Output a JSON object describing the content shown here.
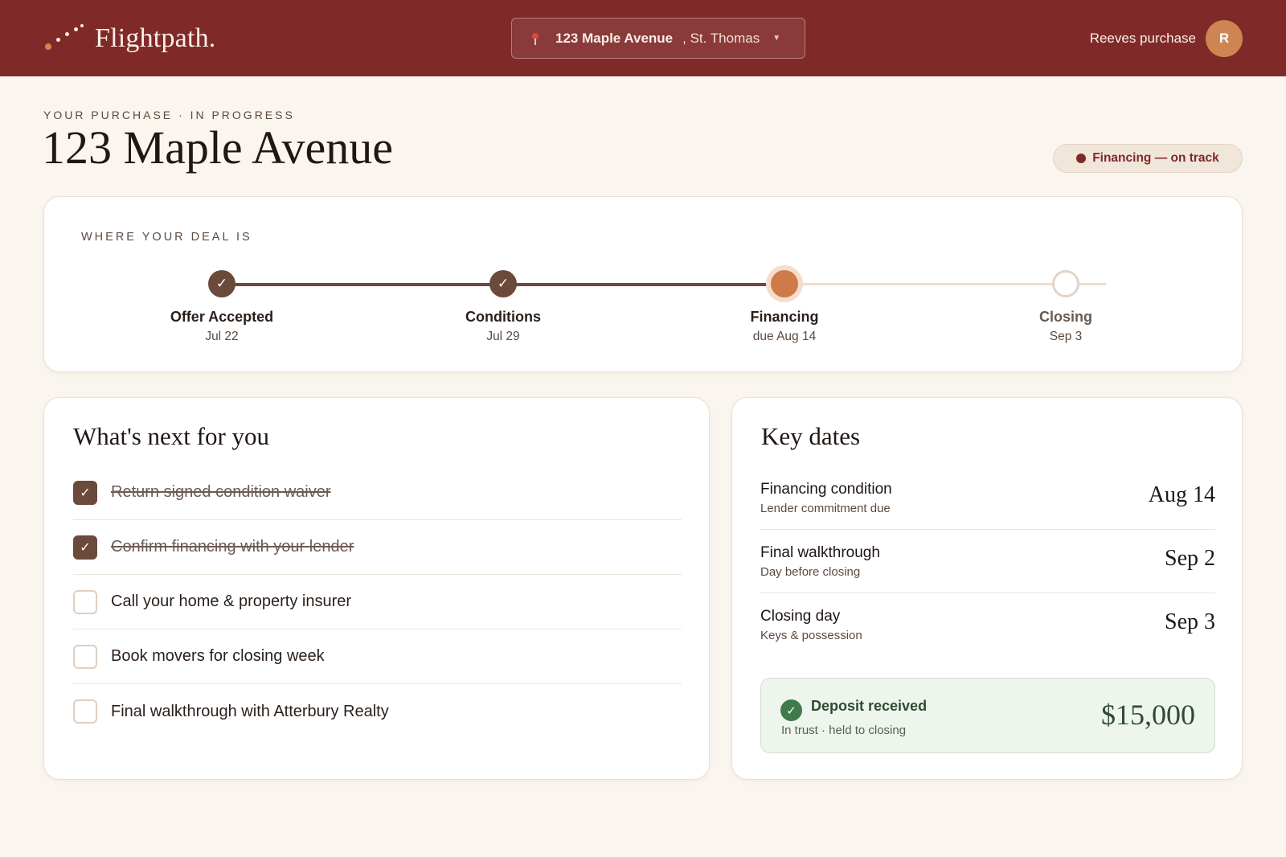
{
  "header": {
    "brand": "Flightpath.",
    "address": {
      "street": "123 Maple Avenue",
      "city": ", St. Thomas"
    },
    "user_label": "Reeves purchase",
    "avatar_initial": "R"
  },
  "page": {
    "eyebrow": "YOUR PURCHASE · IN PROGRESS",
    "title": "123 Maple Avenue",
    "status": "Financing — on track"
  },
  "progress": {
    "label": "WHERE YOUR DEAL IS",
    "steps": [
      {
        "name": "Offer Accepted",
        "date": "Jul 22",
        "state": "done"
      },
      {
        "name": "Conditions",
        "date": "Jul 29",
        "state": "done"
      },
      {
        "name": "Financing",
        "date": "due Aug 14",
        "state": "current"
      },
      {
        "name": "Closing",
        "date": "Sep 3",
        "state": "upcoming"
      }
    ]
  },
  "next": {
    "title": "What's next for you",
    "tasks": [
      {
        "text": "Return signed condition waiver",
        "done": true
      },
      {
        "text": "Confirm financing with your lender",
        "done": true
      },
      {
        "text": "Call your home & property insurer",
        "done": false
      },
      {
        "text": "Book movers for closing week",
        "done": false
      },
      {
        "text": "Final walkthrough with Atterbury Realty",
        "done": false
      }
    ]
  },
  "key_dates": {
    "title": "Key dates",
    "rows": [
      {
        "title": "Financing condition",
        "sub": "Lender commitment due",
        "date": "Aug 14"
      },
      {
        "title": "Final walkthrough",
        "sub": "Day before closing",
        "date": "Sep 2"
      },
      {
        "title": "Closing day",
        "sub": "Keys & possession",
        "date": "Sep 3"
      }
    ],
    "deposit": {
      "title": "Deposit received",
      "sub": "In trust · held to closing",
      "amount": "$15,000"
    }
  },
  "colors": {
    "brand": "#7f2a29",
    "accent": "#cf7a48",
    "done": "#6b4a3b",
    "success": "#3f7a4c"
  },
  "icons": {
    "logo": "flight-dots-icon",
    "address": "map-pin-icon",
    "dropdown": "chevron-down-icon",
    "done": "check-icon"
  }
}
